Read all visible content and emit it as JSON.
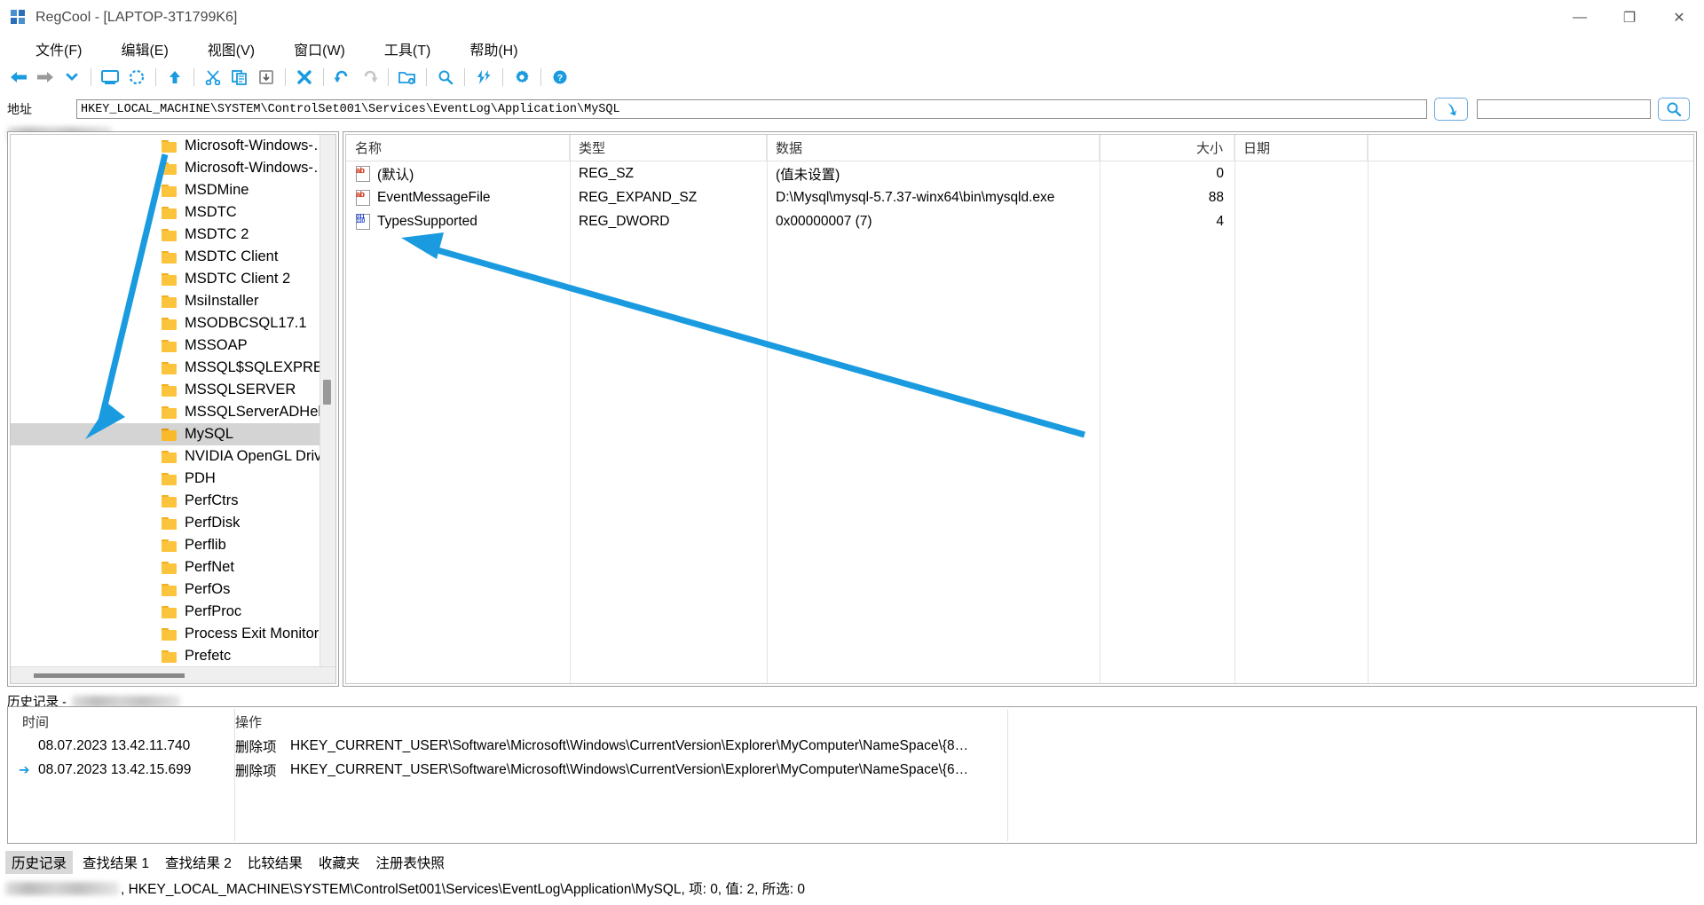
{
  "window": {
    "title": "RegCool - [LAPTOP-3T1799K6]",
    "app_icon": "regcool-logo-icon",
    "minimize": "—",
    "maximize": "❐",
    "close": "✕"
  },
  "menu": [
    {
      "label": "文件(F)",
      "name": "menu-file"
    },
    {
      "label": "编辑(E)",
      "name": "menu-edit"
    },
    {
      "label": "视图(V)",
      "name": "menu-view"
    },
    {
      "label": "窗口(W)",
      "name": "menu-window"
    },
    {
      "label": "工具(T)",
      "name": "menu-tools"
    },
    {
      "label": "帮助(H)",
      "name": "menu-help"
    }
  ],
  "toolbar": {
    "items": [
      {
        "icon": "back-arrow-icon",
        "name": "toolbar-back"
      },
      {
        "icon": "forward-arrow-icon",
        "name": "toolbar-forward"
      },
      {
        "icon": "chevron-down-icon",
        "name": "toolbar-history-dropdown"
      },
      {
        "icon": "computer-icon",
        "name": "toolbar-my-computer"
      },
      {
        "icon": "refresh-icon",
        "name": "toolbar-refresh"
      },
      {
        "icon": "up-arrow-icon",
        "name": "toolbar-up-level"
      },
      {
        "icon": "scissors-icon",
        "name": "toolbar-cut"
      },
      {
        "icon": "copy-icon",
        "name": "toolbar-copy"
      },
      {
        "icon": "paste-icon",
        "name": "toolbar-paste"
      },
      {
        "icon": "delete-x-icon",
        "name": "toolbar-delete"
      },
      {
        "icon": "undo-icon",
        "name": "toolbar-undo"
      },
      {
        "icon": "redo-icon",
        "name": "toolbar-redo"
      },
      {
        "icon": "new-folder-icon",
        "name": "toolbar-new-key"
      },
      {
        "icon": "search-icon",
        "name": "toolbar-find"
      },
      {
        "icon": "lightning-icon",
        "name": "toolbar-quick-action"
      },
      {
        "icon": "gear-icon",
        "name": "toolbar-options"
      },
      {
        "icon": "help-circle-icon",
        "name": "toolbar-help"
      }
    ]
  },
  "address": {
    "label": "地址",
    "value": "HKEY_LOCAL_MACHINE\\SYSTEM\\ControlSet001\\Services\\EventLog\\Application\\MySQL",
    "go_icon": "jump-to-icon",
    "find_placeholder": "",
    "find_value": "",
    "find_icon": "search-icon"
  },
  "tree": {
    "items": [
      {
        "label": "Microsoft-Windows-…",
        "selected": false
      },
      {
        "label": "Microsoft-Windows-…",
        "selected": false
      },
      {
        "label": "MSDMine",
        "selected": false
      },
      {
        "label": "MSDTC",
        "selected": false
      },
      {
        "label": "MSDTC 2",
        "selected": false
      },
      {
        "label": "MSDTC Client",
        "selected": false
      },
      {
        "label": "MSDTC Client 2",
        "selected": false
      },
      {
        "label": "MsiInstaller",
        "selected": false
      },
      {
        "label": "MSODBCSQL17.1",
        "selected": false
      },
      {
        "label": "MSSOAP",
        "selected": false
      },
      {
        "label": "MSSQL$SQLEXPRESS",
        "selected": false
      },
      {
        "label": "MSSQLSERVER",
        "selected": false
      },
      {
        "label": "MSSQLServerADHelp",
        "selected": false
      },
      {
        "label": "MySQL",
        "selected": true
      },
      {
        "label": "NVIDIA OpenGL Driv",
        "selected": false
      },
      {
        "label": "PDH",
        "selected": false
      },
      {
        "label": "PerfCtrs",
        "selected": false
      },
      {
        "label": "PerfDisk",
        "selected": false
      },
      {
        "label": "Perflib",
        "selected": false
      },
      {
        "label": "PerfNet",
        "selected": false
      },
      {
        "label": "PerfOs",
        "selected": false
      },
      {
        "label": "PerfProc",
        "selected": false
      },
      {
        "label": "Process Exit Monitor",
        "selected": false
      },
      {
        "label": "Prefetc",
        "selected": false
      }
    ]
  },
  "values_list": {
    "columns": [
      {
        "label": "名称",
        "name": "column-name"
      },
      {
        "label": "类型",
        "name": "column-type"
      },
      {
        "label": "数据",
        "name": "column-data"
      },
      {
        "label": "大小",
        "name": "column-size"
      },
      {
        "label": "日期",
        "name": "column-date"
      }
    ],
    "rows": [
      {
        "icon": "string-value-icon",
        "name": "(默认)",
        "type": "REG_SZ",
        "data": "(值未设置)",
        "size": "0",
        "date": ""
      },
      {
        "icon": "string-value-icon",
        "name": "EventMessageFile",
        "type": "REG_EXPAND_SZ",
        "data": "D:\\Mysql\\mysql-5.7.37-winx64\\bin\\mysqld.exe",
        "size": "88",
        "date": ""
      },
      {
        "icon": "dword-value-icon",
        "name": "TypesSupported",
        "type": "REG_DWORD",
        "data": "0x00000007 (7)",
        "size": "4",
        "date": ""
      }
    ]
  },
  "history": {
    "title": "历史记录 -",
    "columns": [
      {
        "label": "时间",
        "name": "column-time"
      },
      {
        "label": "操作",
        "name": "column-operation"
      }
    ],
    "rows": [
      {
        "time": "08.07.2023 13.42.11.740",
        "operation": "删除项",
        "path": "HKEY_CURRENT_USER\\Software\\Microsoft\\Windows\\CurrentVersion\\Explorer\\MyComputer\\NameSpace\\{8…",
        "current": false
      },
      {
        "time": "08.07.2023 13.42.15.699",
        "operation": "删除项",
        "path": "HKEY_CURRENT_USER\\Software\\Microsoft\\Windows\\CurrentVersion\\Explorer\\MyComputer\\NameSpace\\{6…",
        "current": true,
        "marker_icon": "current-position-arrow-icon"
      }
    ]
  },
  "bottom_tabs": [
    {
      "label": "历史记录",
      "active": true
    },
    {
      "label": "查找结果 1",
      "active": false
    },
    {
      "label": "查找结果 2",
      "active": false
    },
    {
      "label": "比较结果",
      "active": false
    },
    {
      "label": "收藏夹",
      "active": false
    },
    {
      "label": "注册表快照",
      "active": false
    }
  ],
  "statusbar": {
    "text": ", HKEY_LOCAL_MACHINE\\SYSTEM\\ControlSet001\\Services\\EventLog\\Application\\MySQL, 项: 0, 值: 2, 所选: 0"
  },
  "annotations": {
    "arrow_color": "#1a9be0",
    "arrows": [
      {
        "name": "annotation-arrow-to-mysql-key"
      },
      {
        "name": "annotation-arrow-to-values-list"
      }
    ]
  },
  "colors": {
    "accent": "#1a9be0",
    "folder": "#fcc43c",
    "selection": "#d4d4d4"
  }
}
